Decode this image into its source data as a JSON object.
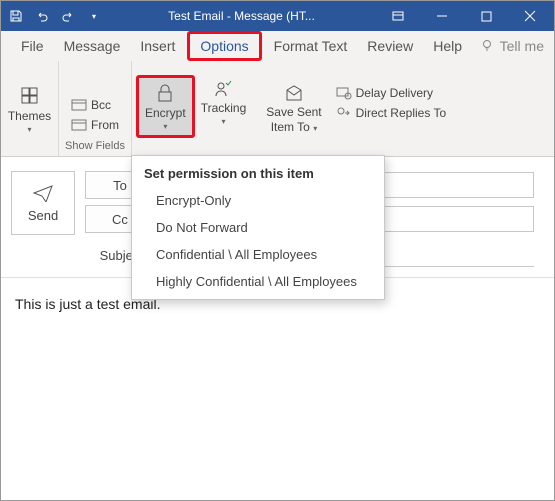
{
  "titlebar": {
    "title": "Test Email - Message (HT..."
  },
  "tabs": {
    "file": "File",
    "message": "Message",
    "insert": "Insert",
    "options": "Options",
    "formattext": "Format Text",
    "review": "Review",
    "help": "Help",
    "tellme": "Tell me"
  },
  "ribbon": {
    "themes": "Themes",
    "bcc": "Bcc",
    "from": "From",
    "showfields": "Show Fields",
    "encrypt": "Encrypt",
    "tracking": "Tracking",
    "savesent": "Save Sent",
    "itemto": "Item To",
    "delay": "Delay Delivery",
    "direct": "Direct Replies To"
  },
  "dropdown": {
    "header": "Set permission on this item",
    "encrypt_only": "Encrypt-Only",
    "dnf": "Do Not Forward",
    "conf": "Confidential \\ All Employees",
    "hconf": "Highly Confidential \\ All Employees"
  },
  "compose": {
    "send": "Send",
    "to": "To",
    "cc": "Cc",
    "subject_label": "Subject"
  },
  "body": {
    "text": "This is just a test email."
  }
}
